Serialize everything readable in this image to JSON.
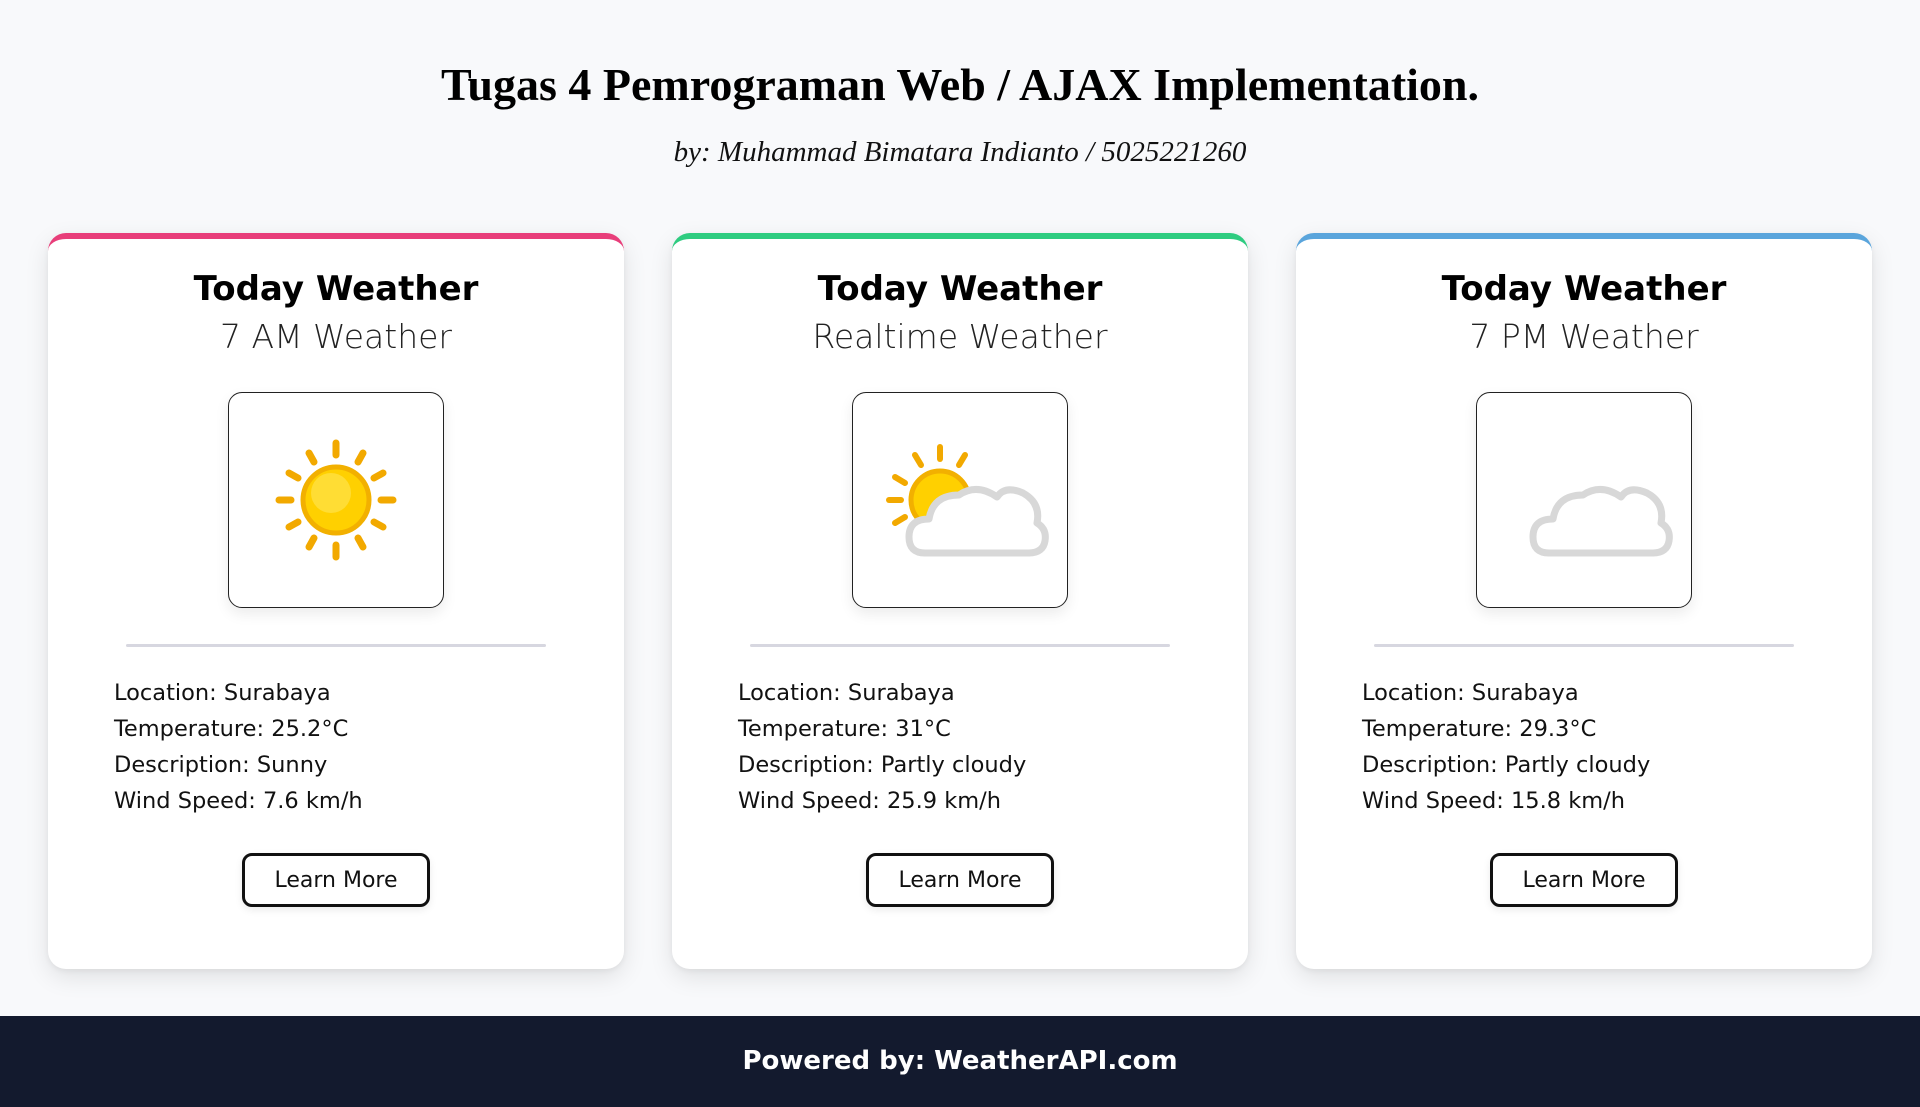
{
  "header": {
    "title": "Tugas 4 Pemrograman Web / AJAX Implementation.",
    "subtitle": "by: Muhammad Bimatara Indianto / 5025221260"
  },
  "cards": [
    {
      "title": "Today Weather",
      "subtitle": "7 AM Weather",
      "accent_color": "#e83e7a",
      "icon": "sun-icon",
      "location_label": "Location:",
      "location": "Surabaya",
      "temperature_label": "Temperature:",
      "temperature": "25.2°C",
      "description_label": "Description:",
      "description": "Sunny",
      "wind_label": "Wind Speed:",
      "wind": "7.6 km/h",
      "button_label": "Learn More"
    },
    {
      "title": "Today Weather",
      "subtitle": "Realtime Weather",
      "accent_color": "#2ecc80",
      "icon": "partly-cloudy-day-icon",
      "location_label": "Location:",
      "location": "Surabaya",
      "temperature_label": "Temperature:",
      "temperature": "31°C",
      "description_label": "Description:",
      "description": "Partly cloudy",
      "wind_label": "Wind Speed:",
      "wind": "25.9 km/h",
      "button_label": "Learn More"
    },
    {
      "title": "Today Weather",
      "subtitle": "7 PM Weather",
      "accent_color": "#5aa5dc",
      "icon": "partly-cloudy-night-icon",
      "location_label": "Location:",
      "location": "Surabaya",
      "temperature_label": "Temperature:",
      "temperature": "29.3°C",
      "description_label": "Description:",
      "description": "Partly cloudy",
      "wind_label": "Wind Speed:",
      "wind": "15.8 km/h",
      "button_label": "Learn More"
    }
  ],
  "footer": {
    "text": "Powered by: WeatherAPI.com",
    "background": "#131a2e"
  },
  "colors": {
    "page_background": "#f8f9fb",
    "sun": "#ffcc00",
    "moon": "#1a6fd0",
    "cloud": "#e6e6e6"
  }
}
